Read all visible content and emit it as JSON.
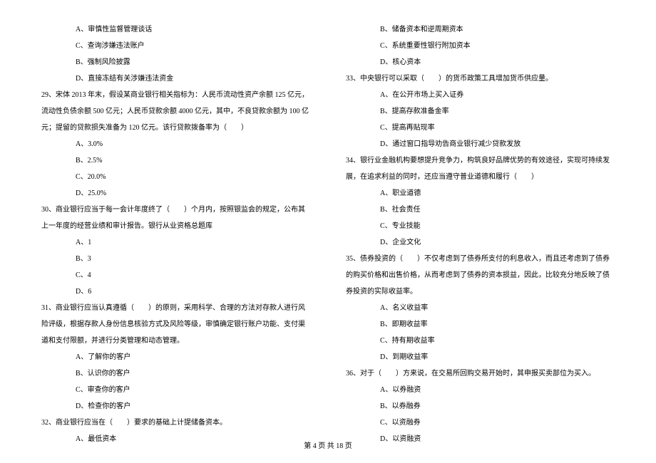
{
  "left_column": [
    {
      "indent": 2,
      "text": "A、审慎性监督管理谈话"
    },
    {
      "indent": 2,
      "text": "C、查询涉嫌违法账户"
    },
    {
      "indent": 2,
      "text": "B、强制风险披露"
    },
    {
      "indent": 2,
      "text": "D、直接冻结有关涉嫌违法资金"
    },
    {
      "indent": 0,
      "text": "29、宋体 2013 年末，假设某商业银行相关指标为：人民币流动性资产余额 125 亿元，流动性负债余额 500 亿元；人民币贷款余额 4000 亿元，其中，不良贷款余额为 100 亿元；提留的贷款损失准备为 120 亿元。该行贷款拨备率为（　　）"
    },
    {
      "indent": 2,
      "text": "A、3.0%"
    },
    {
      "indent": 2,
      "text": "B、2.5%"
    },
    {
      "indent": 2,
      "text": "C、20.0%"
    },
    {
      "indent": 2,
      "text": "D、25.0%"
    },
    {
      "indent": 0,
      "text": "30、商业银行应当于每一会计年度终了（　　）个月内，按照银监会的规定，公布其上一年度的经营业绩和审计报告。银行从业资格总题库"
    },
    {
      "indent": 2,
      "text": "A、1"
    },
    {
      "indent": 2,
      "text": "B、3"
    },
    {
      "indent": 2,
      "text": "C、4"
    },
    {
      "indent": 2,
      "text": "D、6"
    },
    {
      "indent": 0,
      "text": "31、商业银行应当认真遵循（　　）的原则，采用科学、合理的方法对存款人进行风险评级，根据存款人身份信息核验方式及风险等级，审慎确定银行账户功能、支付渠道和支付限额，并进行分类管理和动态管理。"
    },
    {
      "indent": 2,
      "text": "A、了解你的客户"
    },
    {
      "indent": 2,
      "text": "B、认识你的客户"
    },
    {
      "indent": 2,
      "text": "C、审查你的客户"
    },
    {
      "indent": 2,
      "text": "D、检查你的客户"
    },
    {
      "indent": 0,
      "text": "32、商业银行应当在（　　）要求的基础上计提储备资本。"
    },
    {
      "indent": 2,
      "text": "A、最低资本"
    }
  ],
  "right_column": [
    {
      "indent": 2,
      "text": "B、储备资本和逆周期资本"
    },
    {
      "indent": 2,
      "text": "C、系统重要性银行附加资本"
    },
    {
      "indent": 2,
      "text": "D、核心资本"
    },
    {
      "indent": 0,
      "text": "33、中央银行可以采取（　　）的货币政策工具增加货币供应量。"
    },
    {
      "indent": 2,
      "text": "A、在公开市场上买入证券"
    },
    {
      "indent": 2,
      "text": "B、提高存款准备金率"
    },
    {
      "indent": 2,
      "text": "C、提高再贴现率"
    },
    {
      "indent": 2,
      "text": "D、通过窗口指导劝告商业银行减少贷款发放"
    },
    {
      "indent": 0,
      "text": "34、银行业金融机构要想提升竞争力，构筑良好品牌优势的有效途径，实现可持续发展，在追求利益的同时，还应当遵守普业道德和履行（　　）"
    },
    {
      "indent": 2,
      "text": "A、职业道德"
    },
    {
      "indent": 2,
      "text": "B、社会责任"
    },
    {
      "indent": 2,
      "text": "C、专业技能"
    },
    {
      "indent": 2,
      "text": "D、企业文化"
    },
    {
      "indent": 0,
      "text": "35、债券投资的（　　）不仅考虑到了债券所支付的利息收入，而且还考虑到了债券的购买价格和出售价格，从而考虑到了债券的资本损益，因此，比较充分地反映了债券投资的实际收益率。"
    },
    {
      "indent": 2,
      "text": "A、名义收益率"
    },
    {
      "indent": 2,
      "text": "B、即期收益率"
    },
    {
      "indent": 2,
      "text": "C、持有期收益率"
    },
    {
      "indent": 2,
      "text": "D、到期收益率"
    },
    {
      "indent": 0,
      "text": "36、对于（　　）方来说，在交易所回购交易开始时，其申报买卖部位为买入。"
    },
    {
      "indent": 2,
      "text": "A、以券融资"
    },
    {
      "indent": 2,
      "text": "B、以券融券"
    },
    {
      "indent": 2,
      "text": "C、以资融券"
    },
    {
      "indent": 2,
      "text": "D、以资融资"
    }
  ],
  "footer": "第 4 页 共 18 页"
}
